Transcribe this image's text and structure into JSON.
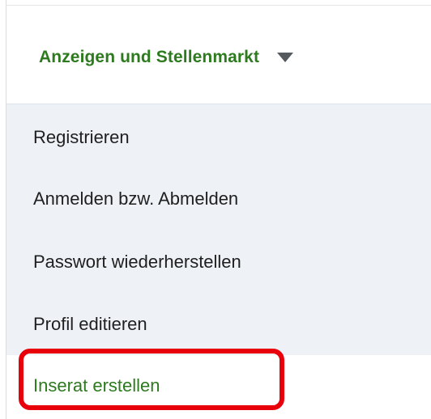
{
  "menu": {
    "header_label": "Anzeigen und Stellenmarkt",
    "header_icon": "caret-down-icon",
    "items": [
      {
        "label": "Registrieren"
      },
      {
        "label": "Anmelden bzw. Abmelden"
      },
      {
        "label": "Passwort wiederherstellen"
      },
      {
        "label": "Profil editieren"
      }
    ],
    "active_item": {
      "label": "Inserat erstellen"
    }
  },
  "colors": {
    "accent_green": "#2d7a1f",
    "submenu_background": "#eef2f6",
    "highlight_red": "#e8000b",
    "text": "#1f1f1f",
    "caret": "#555a5f"
  }
}
